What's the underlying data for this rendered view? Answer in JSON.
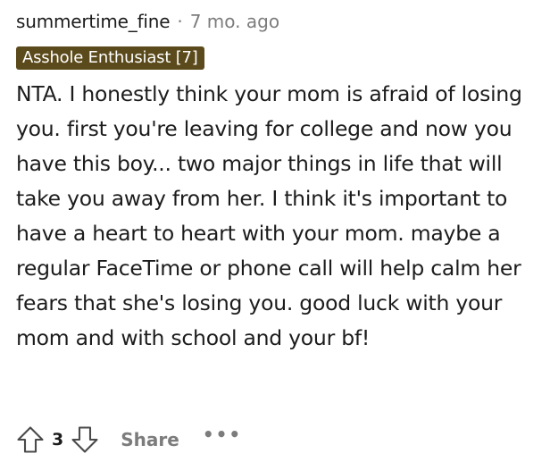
{
  "comment": {
    "username": "summertime_fine",
    "separator": "·",
    "timestamp": "7 mo. ago",
    "flair": "Asshole Enthusiast [7]",
    "body": "NTA. I honestly think your mom is afraid of losing you. first you're leaving for college and now you have this boy... two major things in life that will take you away from her. I think it's important to have a heart to heart with your mom. maybe a regular FaceTime or phone call will help calm her fears that she's losing you. good luck with your mom and with school and your bf!"
  },
  "actions": {
    "upvote_icon": "upvote-arrow-icon",
    "vote_count": "3",
    "downvote_icon": "downvote-arrow-icon",
    "share_label": "Share",
    "more_label": "•••"
  },
  "colors": {
    "flair_background": "#5b4a1b",
    "meta_gray": "#7c7c7c",
    "text": "#1c1c1c"
  }
}
